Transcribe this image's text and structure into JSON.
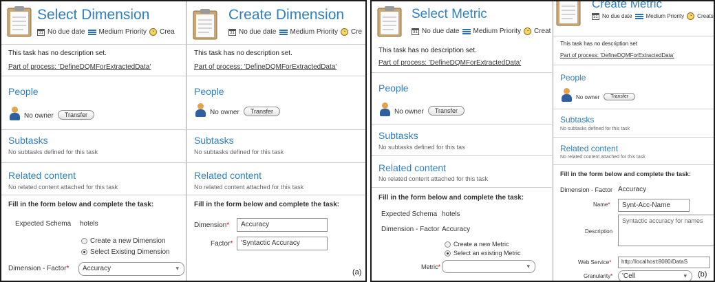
{
  "panel_select_dimension": {
    "title": "Select Dimension",
    "no_due_date": "No due date",
    "priority": "Medium Priority",
    "created_truncated": "Crea",
    "description": "This task has no description set.",
    "process_link": "Part of process: 'DefineDQMForExtractedData'",
    "people_heading": "People",
    "owner_text": "No owner",
    "transfer_label": "Transfer",
    "subtasks_heading": "Subtasks",
    "subtasks_text": "No subtasks defined for this task",
    "related_heading": "Related content",
    "related_text": "No related content attached for this task",
    "form_instruction": "Fill in the form below and complete the task:",
    "schema_label": "Expected Schema",
    "schema_value": "hotels",
    "radio_create": "Create a new Dimension",
    "radio_select": "Select Existing Dimension",
    "dimension_factor_label": "Dimension - Factor",
    "dimension_factor_value": "Accuracy"
  },
  "panel_create_dimension": {
    "title": "Create Dimension",
    "no_due_date": "No due date",
    "priority": "Medium Priority",
    "created_truncated": "Cre",
    "description": "This task has no description set.",
    "process_link": "Part of process: 'DefineDQMForExtractedData'",
    "people_heading": "People",
    "owner_text": "No owner",
    "transfer_label": "Transfer",
    "subtasks_heading": "Subtasks",
    "subtasks_text": "No subtasks defined for this task",
    "related_heading": "Related content",
    "related_text": "No related content attached for this task",
    "form_instruction": "Fill in the form below and complete the task:",
    "dimension_label": "Dimension",
    "dimension_value": "Accuracy",
    "factor_label": "Factor",
    "factor_value": "'Syntactic Accuracy"
  },
  "panel_select_metric": {
    "title": "Select Metric",
    "no_due_date": "No due date",
    "priority": "Medium Priority",
    "created_truncated": "Creat",
    "description": "This task has no description set.",
    "process_link": "Part of process: 'DefineDQMForExtractedData'",
    "people_heading": "People",
    "owner_text": "No owner",
    "transfer_label": "Transfer",
    "subtasks_heading": "Subtasks",
    "subtasks_text": "No subtasks defined for this tas",
    "related_heading": "Related content",
    "related_text": "No related content attached for this task",
    "form_instruction": "Fill in the form below and complete the task:",
    "schema_label": "Expected Schema",
    "schema_value": "hotels",
    "dimension_factor_label": "Dimension - Factor",
    "dimension_factor_value": "Accuracy",
    "radio_create": "Create a new Metric",
    "radio_select": "Select an existing Metric",
    "metric_label": "Metric",
    "metric_value": ""
  },
  "panel_create_metric": {
    "title": "Create Metric",
    "no_due_date": "No due date",
    "priority": "Medium Priority",
    "created_truncated": "Creats",
    "description": "This task has no description set",
    "process_link": "Part of process: 'DefineDQMForExtractedData'",
    "people_heading": "People",
    "owner_text": "No owner",
    "transfer_label": "Transfer",
    "subtasks_heading": "Subtasks",
    "subtasks_text": "No subtasks defined for this task",
    "related_heading": "Related content",
    "related_text": "No related content attached for this task",
    "form_instruction": "Fill in the form below and complete the task:",
    "dimension_factor_label": "Dimension - Factor",
    "dimension_factor_value": "Accuracy",
    "name_label": "Name",
    "name_value": "Synt-Acc-Name",
    "description_label": "Description",
    "description_value": "Syntactic accuracy for names",
    "web_service_label": "Web Service",
    "web_service_value": "http://localhost:8080/DataS",
    "granularity_label": "Granularity",
    "granularity_value": "'Cell"
  },
  "figure_labels": {
    "a": "(a)",
    "b": "(b)"
  },
  "icons": {
    "task": "clipboard-icon",
    "calendar": "calendar-icon",
    "priority": "priority-icon",
    "created": "clock-icon",
    "owner": "person-icon",
    "dropdown": "chevron-down-icon"
  },
  "colors": {
    "heading": "#2f7fc1",
    "required": "#dd0000",
    "frame": "#1a1a1a"
  }
}
